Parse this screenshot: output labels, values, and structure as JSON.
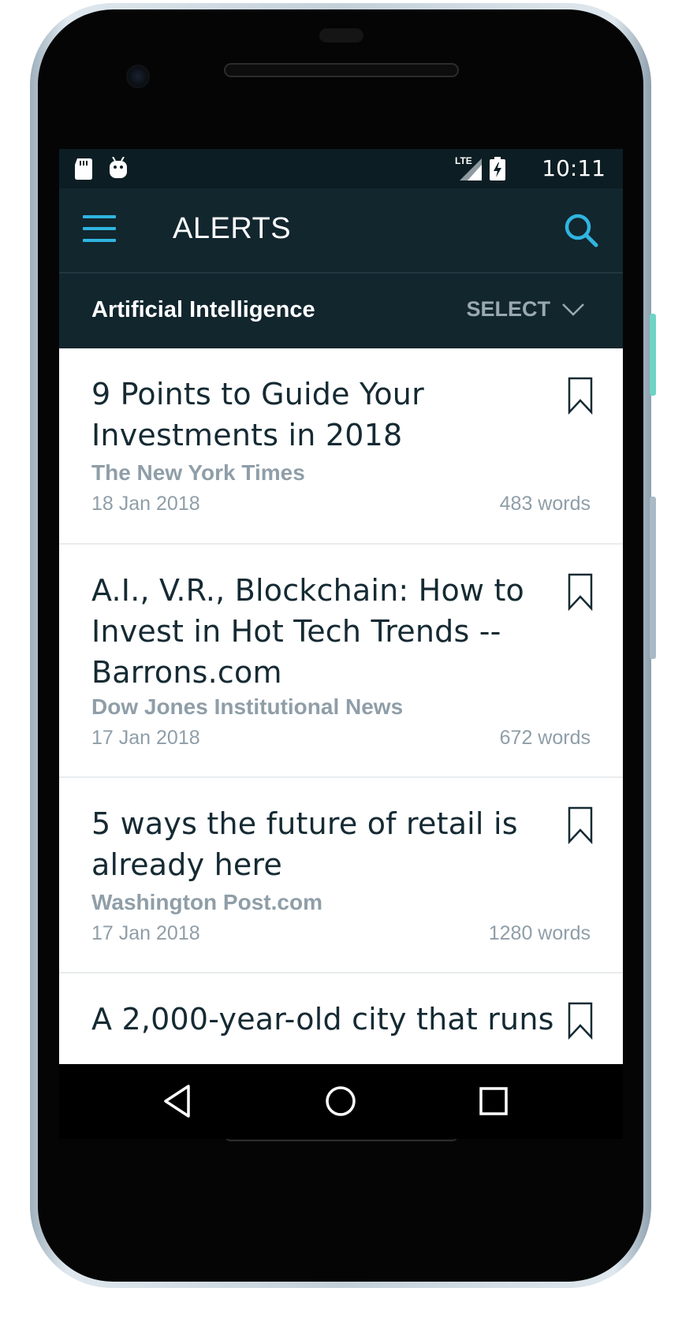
{
  "status_bar": {
    "time": "10:11",
    "network": "LTE",
    "left_icons": [
      "sd-card-icon",
      "android-debug-icon"
    ],
    "right_icons": [
      "signal-icon",
      "battery-charging-icon"
    ]
  },
  "app_bar": {
    "title": "ALERTS",
    "menu_icon": "hamburger-menu-icon",
    "search_icon": "search-icon",
    "accent_color": "#2fb5e0",
    "background_color": "#12262e"
  },
  "topic_bar": {
    "topic": "Artificial Intelligence",
    "select_label": "SELECT"
  },
  "articles": [
    {
      "title": "9 Points to Guide Your Investments in 2018",
      "source": "The New York Times",
      "date": "18 Jan 2018",
      "words": "483 words"
    },
    {
      "title": "A.I., V.R., Blockchain: How to Invest in Hot Tech Trends -- Barrons.com",
      "source": "Dow Jones Institutional News",
      "date": "17 Jan 2018",
      "words": "672 words"
    },
    {
      "title": "5 ways the future of retail is already here",
      "source": "Washington Post.com",
      "date": "17 Jan 2018",
      "words": "1280 words"
    },
    {
      "title": "A 2,000-year-old city that runs"
    }
  ],
  "nav_bar": {
    "back_icon": "back-triangle-icon",
    "home_icon": "home-circle-icon",
    "recents_icon": "recents-square-icon"
  }
}
